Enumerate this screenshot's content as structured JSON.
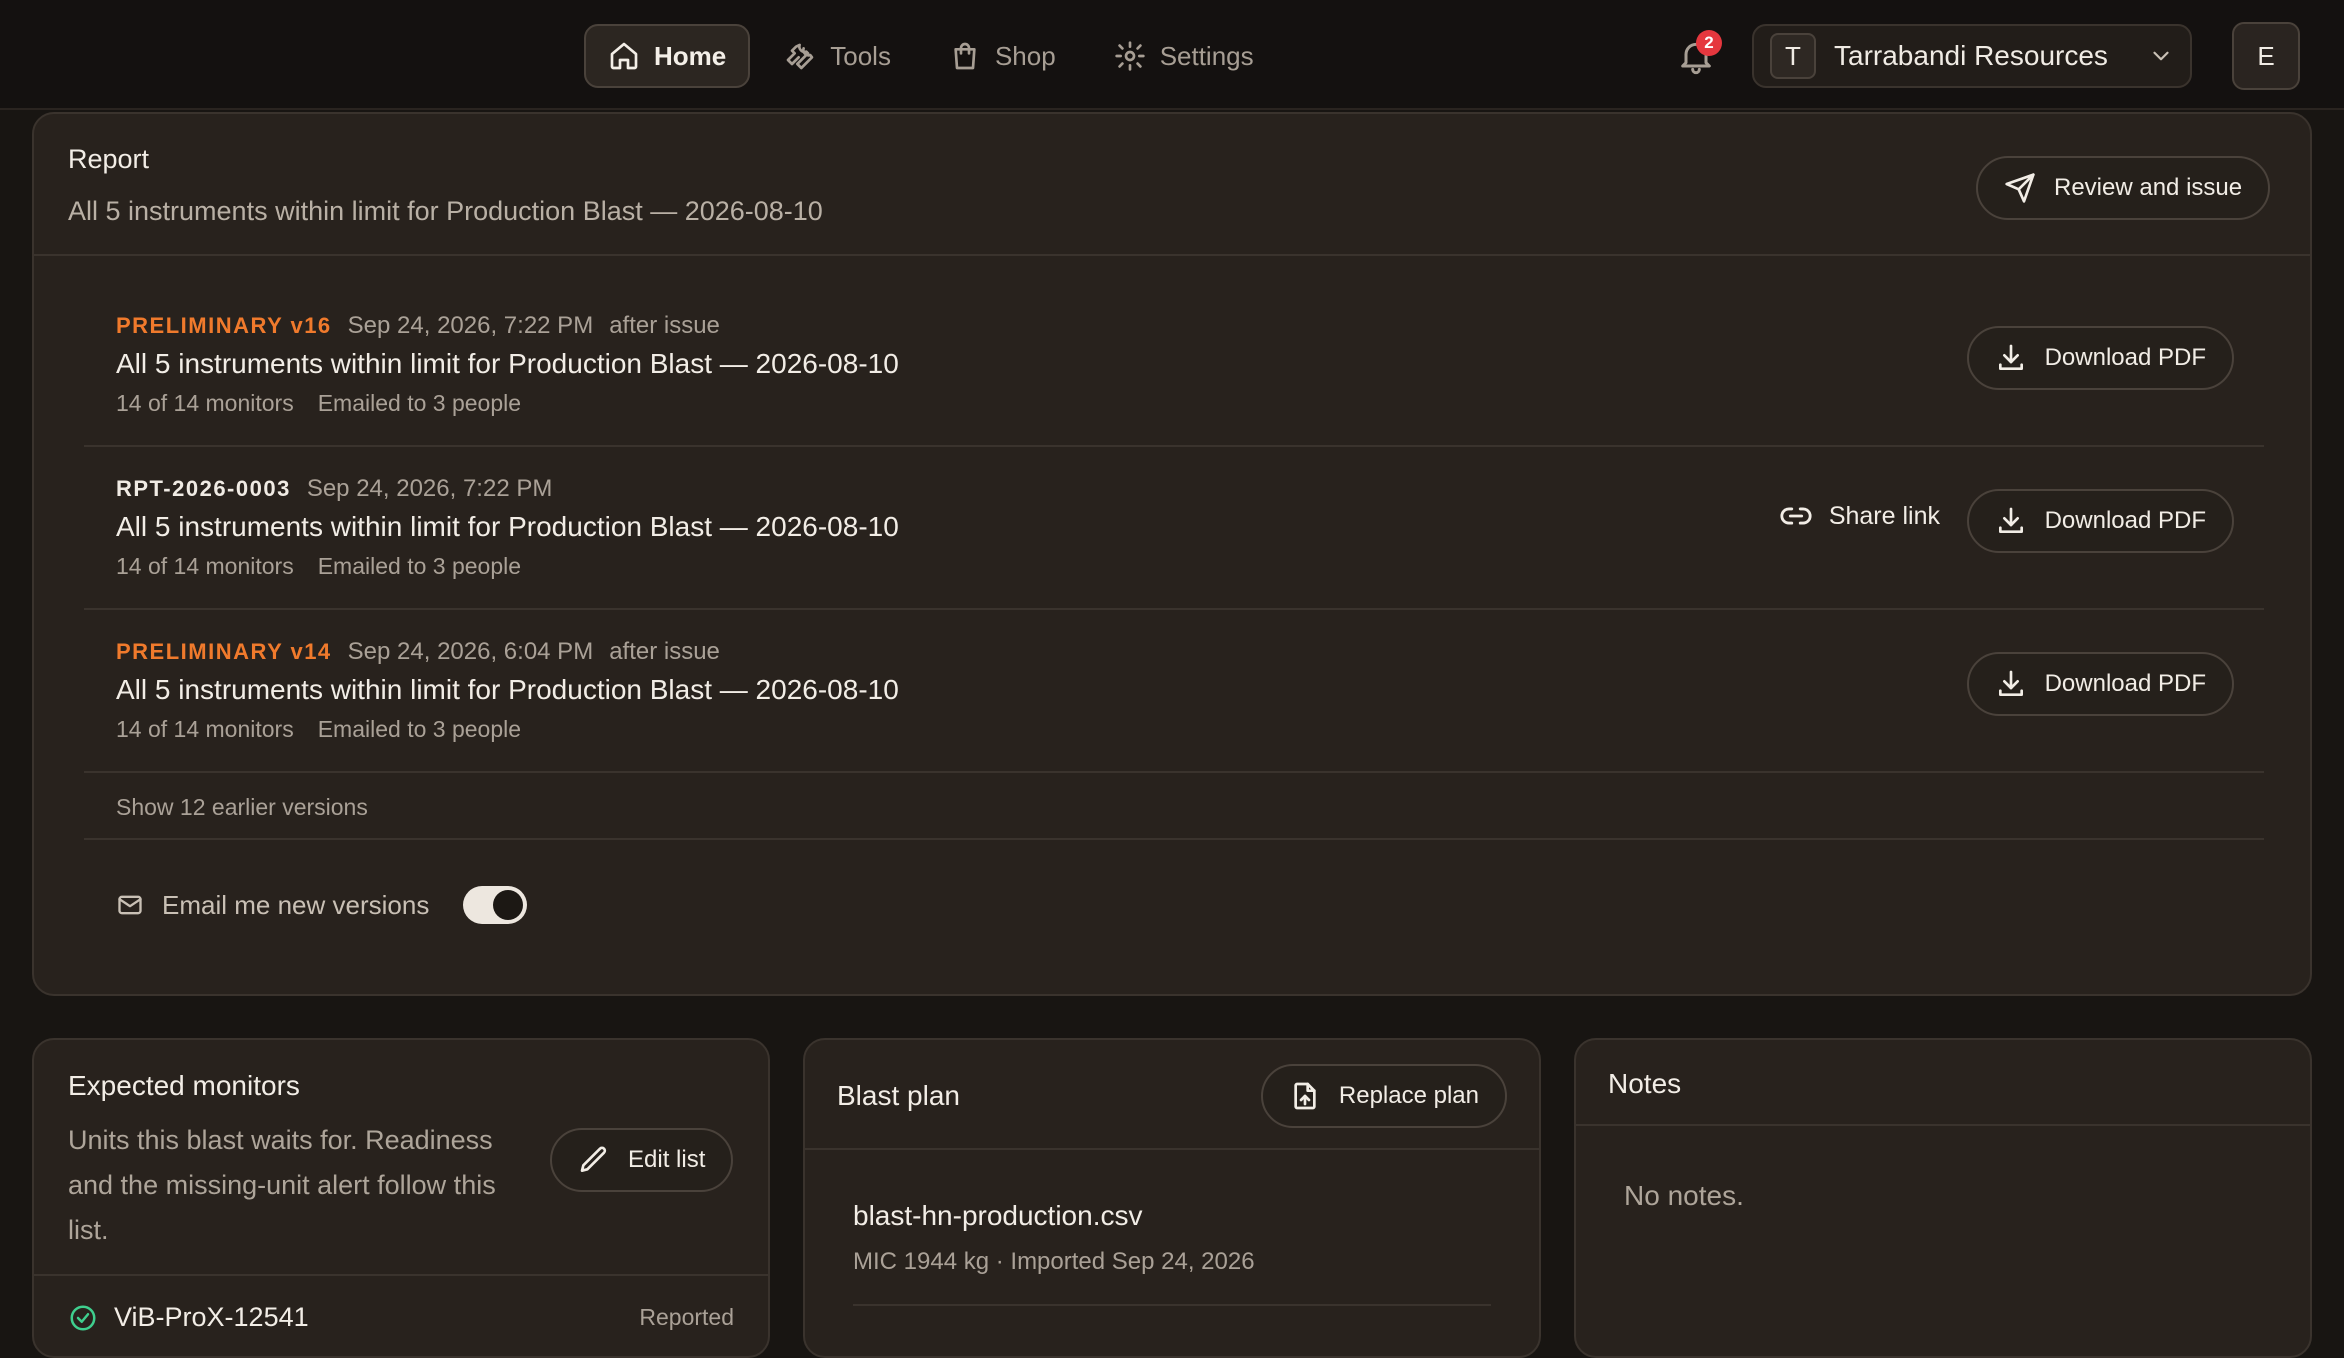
{
  "nav": {
    "items": [
      {
        "label": "Home",
        "icon": "home-icon",
        "active": true
      },
      {
        "label": "Tools",
        "icon": "wrench-icon",
        "active": false
      },
      {
        "label": "Shop",
        "icon": "shopping-bag-icon",
        "active": false
      },
      {
        "label": "Settings",
        "icon": "gear-icon",
        "active": false
      }
    ],
    "notifications_count": "2",
    "org": {
      "initial": "T",
      "name": "Tarrabandi Resources"
    },
    "user_initial": "E"
  },
  "report": {
    "title": "Report",
    "subtitle": "All 5 instruments within limit for Production Blast — 2026-08-10",
    "review_label": "Review and issue",
    "versions": [
      {
        "tag": "PRELIMINARY v16",
        "preliminary": true,
        "date": "Sep 24, 2026, 7:22 PM",
        "note": "after issue",
        "title": "All 5 instruments within limit for Production Blast — 2026-08-10",
        "monitors": "14 of 14 monitors",
        "emailed": "Emailed to 3 people",
        "download_label": "Download PDF"
      },
      {
        "tag": "RPT-2026-0003",
        "preliminary": false,
        "date": "Sep 24, 2026, 7:22 PM",
        "note": "",
        "title": "All 5 instruments within limit for Production Blast — 2026-08-10",
        "monitors": "14 of 14 monitors",
        "emailed": "Emailed to 3 people",
        "share_label": "Share link",
        "download_label": "Download PDF"
      },
      {
        "tag": "PRELIMINARY v14",
        "preliminary": true,
        "date": "Sep 24, 2026, 6:04 PM",
        "note": "after issue",
        "title": "All 5 instruments within limit for Production Blast — 2026-08-10",
        "monitors": "14 of 14 monitors",
        "emailed": "Emailed to 3 people",
        "download_label": "Download PDF"
      }
    ],
    "show_earlier": "Show 12 earlier versions",
    "email_label": "Email me new versions",
    "email_enabled": true
  },
  "monitors": {
    "title": "Expected monitors",
    "description": "Units this blast waits for. Readiness and the missing-unit alert follow this list.",
    "edit_label": "Edit list",
    "items": [
      {
        "name": "ViB-ProX-12541",
        "status": "Reported"
      }
    ]
  },
  "blast_plan": {
    "title": "Blast plan",
    "replace_label": "Replace plan",
    "file_name": "blast-hn-production.csv",
    "file_meta": "MIC 1944 kg · Imported Sep 24, 2026"
  },
  "notes": {
    "title": "Notes",
    "empty": "No notes."
  },
  "colors": {
    "background": "#181512",
    "card": "#28221d",
    "preliminary_tag": "#f07a2c",
    "badge": "#e5373e",
    "success": "#3fcf8e"
  }
}
